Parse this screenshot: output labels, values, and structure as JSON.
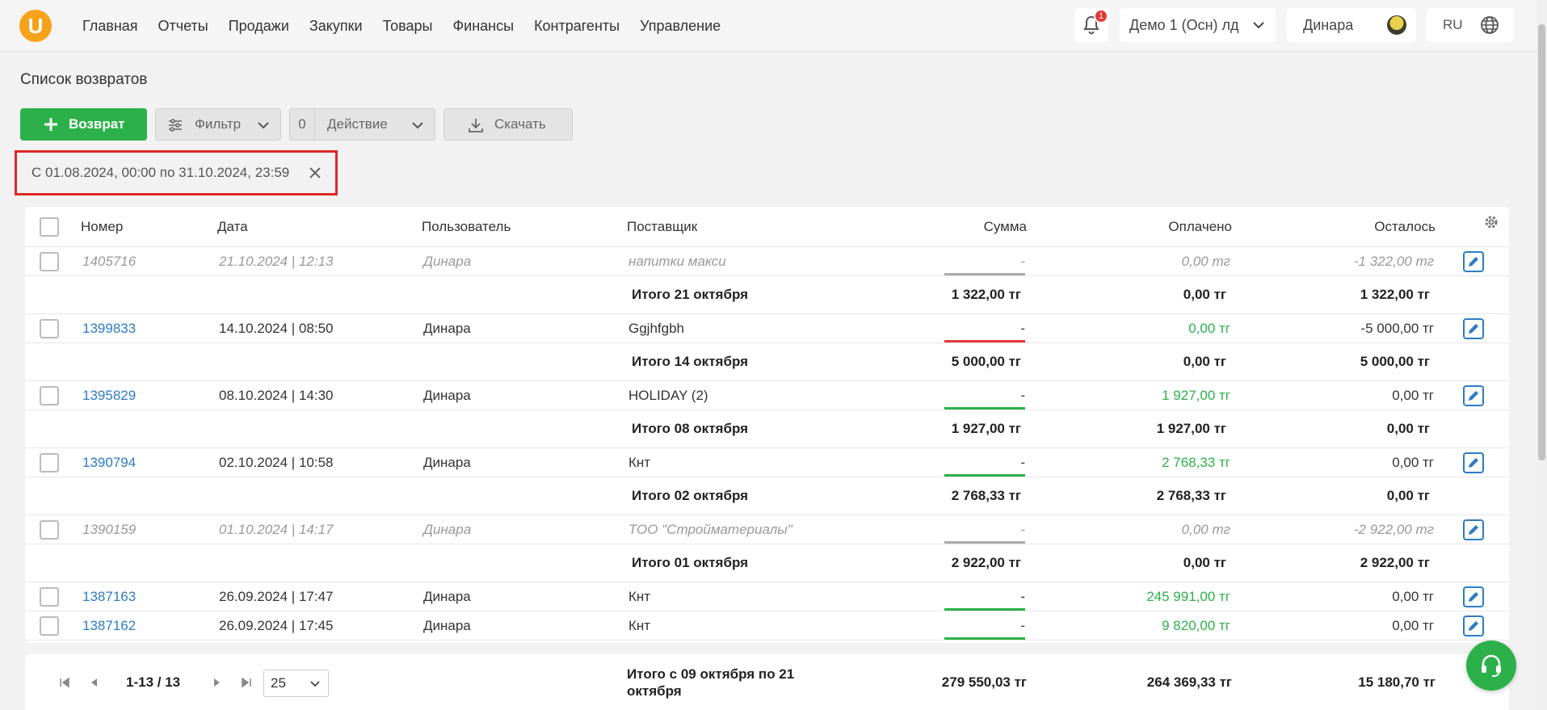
{
  "header": {
    "logo_letter": "U",
    "nav": [
      "Главная",
      "Отчеты",
      "Продажи",
      "Закупки",
      "Товары",
      "Финансы",
      "Контрагенты",
      "Управление"
    ],
    "notifications_count": "1",
    "company": "Демо 1 (Осн) лд",
    "user": "Динара",
    "lang": "RU"
  },
  "page": {
    "title": "Список возвратов",
    "add_button": "Возврат",
    "filter_button": "Фильтр",
    "action_count": "0",
    "action_button": "Действие",
    "download_button": "Скачать",
    "date_filter": "С 01.08.2024, 00:00 по 31.10.2024, 23:59"
  },
  "table": {
    "columns": {
      "number": "Номер",
      "date": "Дата",
      "user": "Пользователь",
      "supplier": "Поставщик",
      "sum": "Сумма",
      "paid": "Оплачено",
      "remaining": "Осталось"
    },
    "rows": [
      {
        "kind": "item",
        "style": "muted",
        "number": "1405716",
        "date": "21.10.2024 | 12:13",
        "user": "Динара",
        "supplier": "напитки макси",
        "sum": "-",
        "paid": "0,00 тг",
        "remaining": "-1 322,00 тг",
        "bar": "#aaaaaa"
      },
      {
        "kind": "total",
        "label": "Итого 21 октября",
        "sum": "1 322,00 тг",
        "paid": "0,00 тг",
        "remaining": "1 322,00 тг"
      },
      {
        "kind": "item",
        "style": "normal",
        "number": "1399833",
        "date": "14.10.2024 | 08:50",
        "user": "Динара",
        "supplier": "Ggjhfgbh",
        "sum": "-",
        "paid": "0,00 тг",
        "remaining": "-5 000,00 тг",
        "bar": "#e53935"
      },
      {
        "kind": "total",
        "label": "Итого 14 октября",
        "sum": "5 000,00 тг",
        "paid": "0,00 тг",
        "remaining": "5 000,00 тг"
      },
      {
        "kind": "item",
        "style": "normal",
        "number": "1395829",
        "date": "08.10.2024 | 14:30",
        "user": "Динара",
        "supplier": "HOLIDAY (2)",
        "sum": "-",
        "paid": "1 927,00 тг",
        "remaining": "0,00 тг",
        "bar": "#2cb14a"
      },
      {
        "kind": "total",
        "label": "Итого 08 октября",
        "sum": "1 927,00 тг",
        "paid": "1 927,00 тг",
        "remaining": "0,00 тг"
      },
      {
        "kind": "item",
        "style": "normal",
        "number": "1390794",
        "date": "02.10.2024 | 10:58",
        "user": "Динара",
        "supplier": "Кнт",
        "sum": "-",
        "paid": "2 768,33 тг",
        "remaining": "0,00 тг",
        "bar": "#2cb14a"
      },
      {
        "kind": "total",
        "label": "Итого 02 октября",
        "sum": "2 768,33 тг",
        "paid": "2 768,33 тг",
        "remaining": "0,00 тг"
      },
      {
        "kind": "item",
        "style": "muted",
        "number": "1390159",
        "date": "01.10.2024 | 14:17",
        "user": "Динара",
        "supplier": "ТОО \"Стройматериалы\"",
        "sum": "-",
        "paid": "0,00 тг",
        "remaining": "-2 922,00 тг",
        "bar": "#aaaaaa"
      },
      {
        "kind": "total",
        "label": "Итого 01 октября",
        "sum": "2 922,00 тг",
        "paid": "0,00 тг",
        "remaining": "2 922,00 тг"
      },
      {
        "kind": "item",
        "style": "normal",
        "number": "1387163",
        "date": "26.09.2024 | 17:47",
        "user": "Динара",
        "supplier": "Кнт",
        "sum": "-",
        "paid": "245 991,00 тг",
        "remaining": "0,00 тг",
        "bar": "#2cb14a"
      },
      {
        "kind": "item",
        "style": "normal",
        "number": "1387162",
        "date": "26.09.2024 | 17:45",
        "user": "Динара",
        "supplier": "Кнт",
        "sum": "-",
        "paid": "9 820,00 тг",
        "remaining": "0,00 тг",
        "bar": "#2cb14a"
      }
    ]
  },
  "footer": {
    "range": "1-13 / 13",
    "page_size": "25",
    "total_label": "Итого с 09 октября по 21 октября",
    "sum": "279 550,03 тг",
    "paid": "264 369,33 тг",
    "remaining": "15 180,70 тг"
  },
  "colors": {
    "accent_green": "#2cb14a",
    "link_blue": "#2c7cc4",
    "highlight_red": "#e02828",
    "logo_orange": "#f6a21a"
  }
}
